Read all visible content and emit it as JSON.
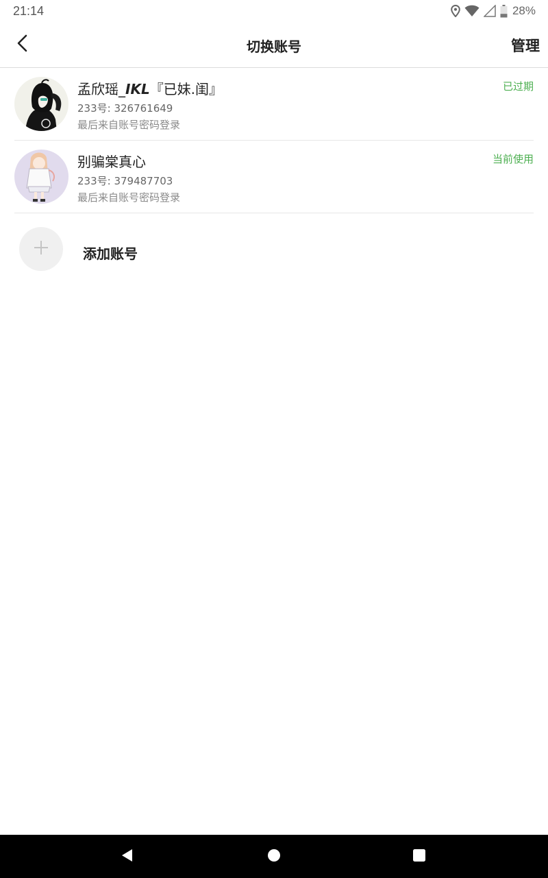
{
  "status_bar": {
    "time": "21:14",
    "battery_percent": "28%",
    "icons": [
      "location-icon",
      "wifi-icon",
      "signal-icon",
      "battery-icon"
    ]
  },
  "app_bar": {
    "title": "切换账号",
    "manage_label": "管理",
    "back_icon": "back-chevron-icon"
  },
  "accounts": [
    {
      "name_prefix": "孟欣瑶_",
      "name_emphasis": "IKL",
      "name_suffix": "『已妹.闺』",
      "id_text": "233号: 326761649",
      "login_text": "最后来自账号密码登录",
      "status": "已过期"
    },
    {
      "name": "别骗棠真心",
      "id_text": "233号: 379487703",
      "login_text": "最后来自账号密码登录",
      "status": "当前使用"
    }
  ],
  "add_account": {
    "label": "添加账号",
    "icon": "plus-icon"
  },
  "nav_bar": {
    "icons": [
      "back-triangle-icon",
      "home-circle-icon",
      "recents-square-icon"
    ]
  },
  "colors": {
    "status_green": "#4caf50",
    "divider": "#e6e6e6",
    "nav_bg": "#000000"
  }
}
